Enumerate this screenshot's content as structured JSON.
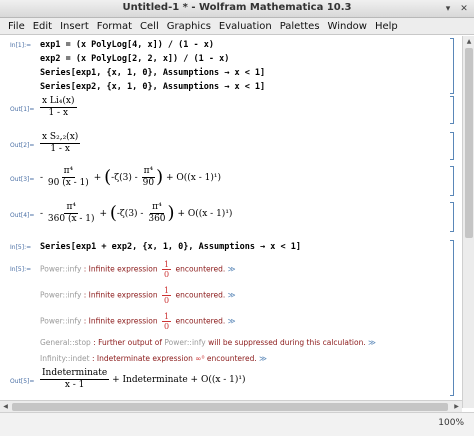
{
  "window": {
    "title": "Untitled-1 * - Wolfram Mathematica 10.3",
    "controls": [
      "▾",
      "✕"
    ]
  },
  "menu": [
    "File",
    "Edit",
    "Insert",
    "Format",
    "Cell",
    "Graphics",
    "Evaluation",
    "Palettes",
    "Window",
    "Help"
  ],
  "cells": {
    "in1": {
      "label": "In[1]:=",
      "line1": "exp1 = (x PolyLog[4, x]) / (1 - x)",
      "line2": "exp2 = (x PolyLog[2, 2, x]) / (1 - x)",
      "line3": "Series[exp1, {x, 1, 0}, Assumptions → x < 1]",
      "line4": "Series[exp2, {x, 1, 0}, Assumptions → x < 1]"
    },
    "out1": {
      "label": "Out[1]=",
      "num": "x Li₄(x)",
      "den": "1 - x"
    },
    "out2": {
      "label": "Out[2]=",
      "num": "x S₂,₂(x)",
      "den": "1 - x"
    },
    "out3": {
      "label": "Out[3]=",
      "lead_sign": "-",
      "f1_num": "π⁴",
      "f1_den": "90 (x - 1)",
      "plus": "+",
      "paren_inner": "-ζ(3) -",
      "f2_num": "π⁴",
      "f2_den": "90",
      "tail": "+ O((x - 1)¹)"
    },
    "out4": {
      "label": "Out[4]=",
      "lead_sign": "-",
      "f1_num": "π⁴",
      "f1_den": "360 (x - 1)",
      "plus": "+",
      "paren_inner": "-ζ(3) -",
      "f2_num": "π⁴",
      "f2_den": "360",
      "tail": "+ O((x - 1)¹)"
    },
    "in5": {
      "label": "In[5]:=",
      "line1": "Series[exp1 + exp2, {x, 1, 0}, Assumptions → x < 1]"
    },
    "messages": [
      {
        "label": "In[5]:=",
        "tag": "Power::infy",
        "text": " : Infinite expression ",
        "frac_num": "1",
        "frac_den": "0",
        "tail": " encountered. ",
        "link": "≫"
      },
      {
        "tag": "Power::infy",
        "text": " : Infinite expression ",
        "frac_num": "1",
        "frac_den": "0",
        "tail": " encountered. ",
        "link": "≫"
      },
      {
        "tag": "Power::infy",
        "text": " : Infinite expression ",
        "frac_num": "1",
        "frac_den": "0",
        "tail": " encountered. ",
        "link": "≫"
      },
      {
        "tag": "General::stop",
        "text": " : Further output of ",
        "ref": "Power::infy",
        "tail": " will be suppressed during this calculation. ",
        "link": "≫"
      },
      {
        "tag": "Infinity::indet",
        "text": " : Indeterminate expression ",
        "expr": "∞⁰",
        "tail": " encountered. ",
        "link": "≫"
      }
    ],
    "out5": {
      "label": "Out[5]=",
      "num": "Indeterminate",
      "den": "x - 1",
      "tail": "+ Indeterminate + O((x - 1)¹)"
    }
  },
  "status": {
    "zoom": "100%"
  },
  "colors": {
    "code_var": "#2c6bd6",
    "message": "#8b1a1a",
    "label": "#4a6fa5"
  }
}
